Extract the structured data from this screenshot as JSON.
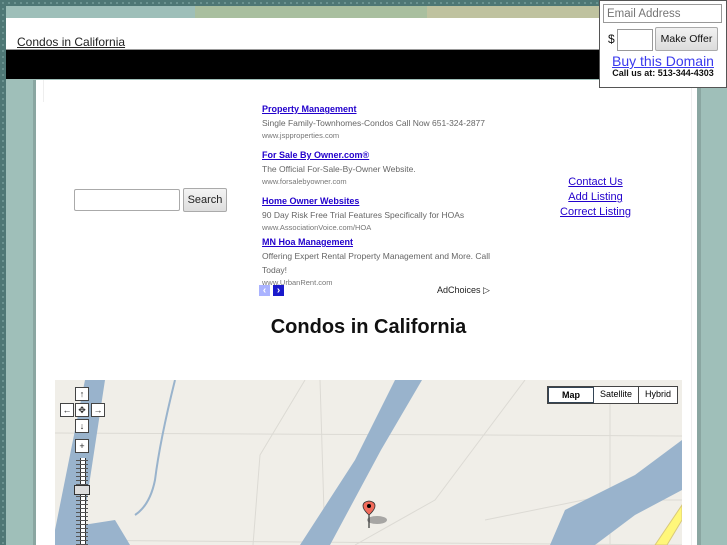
{
  "site": {
    "header_link": "Condos in California",
    "page_title": "Condos in California"
  },
  "search": {
    "input_value": "",
    "button_label": "Search"
  },
  "ads": {
    "items": [
      {
        "title": "Property Management",
        "description": "Single Family-Townhomes-Condos Call Now 651-324-2877",
        "url": "www.jspproperties.com"
      },
      {
        "title": "For Sale By Owner.com®",
        "description": "The Official For-Sale-By-Owner Website.",
        "url": "www.forsalebyowner.com"
      },
      {
        "title": "Home Owner Websites",
        "description": "90 Day Risk Free Trial Features Specifically for HOAs",
        "url": "www.AssociationVoice.com/HOA"
      },
      {
        "title": "MN Hoa Management",
        "description": "Offering Expert Rental Property Management and More. Call Today!",
        "url": "www.UrbanRent.com"
      }
    ],
    "prev_icon": "‹",
    "next_icon": "›",
    "adchoices_label": "AdChoices",
    "adchoices_icon": "▷"
  },
  "links": {
    "items": [
      "Contact Us",
      "Add Listing",
      "Correct Listing"
    ]
  },
  "map": {
    "types": [
      "Map",
      "Satellite",
      "Hybrid"
    ],
    "active_type": "Map",
    "controls": {
      "up": "↑",
      "down": "↓",
      "left": "←",
      "right": "→",
      "center": "✥",
      "zoom_in": "+",
      "zoom_out": "−"
    },
    "colors": {
      "land": "#f0eee8",
      "water": "#99b3cc",
      "road": "#fff77a",
      "marker": "#f26b5b"
    }
  },
  "offer_box": {
    "email_placeholder": "Email Address",
    "currency": "$",
    "amount_value": "",
    "make_offer_label": "Make Offer",
    "buy_link": "Buy this Domain",
    "call_text": "Call us at: 513-344-4303"
  }
}
